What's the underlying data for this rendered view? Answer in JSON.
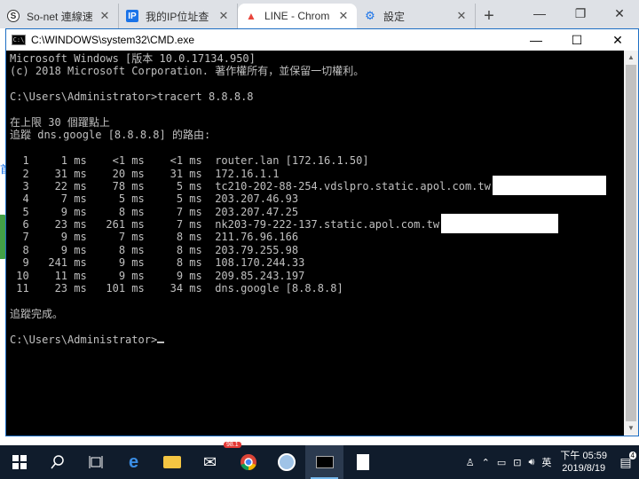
{
  "browser": {
    "tabs": [
      {
        "label": "So-net 連線速",
        "icon": "So",
        "color": "#ffffff"
      },
      {
        "label": "我的IP位址查",
        "icon": "IP",
        "color": "#1a73e8"
      },
      {
        "label": "LINE - Chrom",
        "icon": "▲",
        "color": "#ffffff"
      },
      {
        "label": "設定",
        "icon": "⚙",
        "color": "#1a73e8"
      }
    ],
    "new_tab": "+",
    "side_text": "首"
  },
  "cmd": {
    "title": "C:\\WINDOWS\\system32\\CMD.exe",
    "lines": [
      "Microsoft Windows [版本 10.0.17134.950]",
      "(c) 2018 Microsoft Corporation. 著作權所有，並保留一切權利。",
      "",
      "C:\\Users\\Administrator>tracert 8.8.8.8",
      "",
      "在上限 30 個躍點上",
      "追蹤 dns.google [8.8.8.8] 的路由:",
      "",
      "  1     1 ms    <1 ms    <1 ms  router.lan [172.16.1.50]",
      "  2    31 ms    20 ms    31 ms  172.16.1.1",
      "  3    22 ms    78 ms     5 ms  tc210-202-88-254.vdslpro.static.apol.com.tw",
      "  4     7 ms     5 ms     5 ms  203.207.46.93",
      "  5     9 ms     8 ms     7 ms  203.207.47.25",
      "  6    23 ms   261 ms     7 ms  nk203-79-222-137.static.apol.com.tw",
      "  7     9 ms     7 ms     8 ms  211.76.96.166",
      "  8     9 ms     8 ms     8 ms  203.79.255.98",
      "  9   241 ms     9 ms     8 ms  108.170.244.33",
      " 10    11 ms     9 ms     9 ms  209.85.243.197",
      " 11    23 ms   101 ms    34 ms  dns.google [8.8.8.8]",
      "",
      "追蹤完成。",
      "",
      "C:\\Users\\Administrator>"
    ]
  },
  "taskbar": {
    "time": "下午 05:59",
    "date": "2019/8/19",
    "ime": "英",
    "notification_count": "4",
    "badge": "98.1"
  }
}
